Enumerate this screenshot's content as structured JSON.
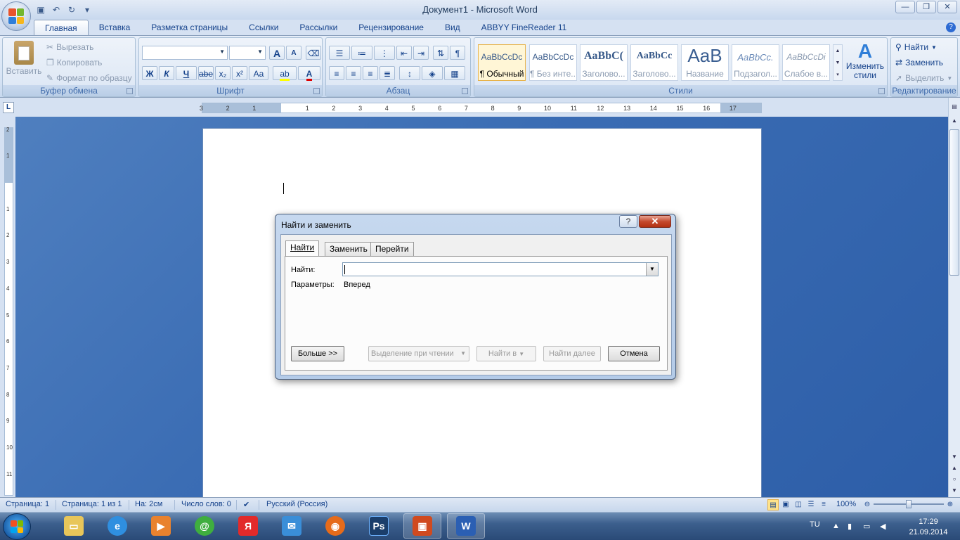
{
  "window": {
    "title": "Документ1 - Microsoft Word"
  },
  "colors": {
    "accent": "#15428b",
    "ribbon": "#d7e4f5",
    "doc_bg": "#3b6db4",
    "close": "#c54a2e"
  },
  "ribbon_tabs": [
    "Главная",
    "Вставка",
    "Разметка страницы",
    "Ссылки",
    "Рассылки",
    "Рецензирование",
    "Вид",
    "ABBYY FineReader 11"
  ],
  "clipboard": {
    "paste": "Вставить",
    "cut": "Вырезать",
    "copy": "Копировать",
    "format_painter": "Формат по образцу",
    "label": "Буфер обмена"
  },
  "font": {
    "label": "Шрифт",
    "bold": "Ж",
    "italic": "К",
    "underline": "Ч",
    "strike": "abe",
    "sub": "x₂",
    "sup": "x²",
    "case": "Aa",
    "grow": "A",
    "shrink": "A"
  },
  "paragraph": {
    "label": "Абзац"
  },
  "styles": {
    "label": "Стили",
    "items": [
      {
        "sample": "AaBbCcDc",
        "name": "¶ Обычный"
      },
      {
        "sample": "AaBbCcDc",
        "name": "¶ Без инте..."
      },
      {
        "sample": "AaBbC(",
        "name": "Заголово..."
      },
      {
        "sample": "AaBbCc",
        "name": "Заголово..."
      },
      {
        "sample": "AaB",
        "name": "Название"
      },
      {
        "sample": "AaBbCc.",
        "name": "Подзагол..."
      },
      {
        "sample": "AaBbCcDi",
        "name": "Слабое в..."
      }
    ],
    "change_styles": "Изменить стили"
  },
  "editing": {
    "label": "Редактирование",
    "find": "Найти",
    "replace": "Заменить",
    "select": "Выделить"
  },
  "ruler": {
    "h_ticks": [
      "3",
      "2",
      "1",
      "1",
      "2",
      "3",
      "4",
      "5",
      "6",
      "7",
      "8",
      "9",
      "10",
      "11",
      "12",
      "13",
      "14",
      "15",
      "16",
      "17"
    ],
    "v_ticks": [
      "2",
      "1",
      "1",
      "2",
      "3",
      "4",
      "5",
      "6",
      "7",
      "8",
      "9",
      "10",
      "11"
    ],
    "corner": "L"
  },
  "dialog": {
    "title": "Найти и заменить",
    "help": "?",
    "close": "✕",
    "tabs": [
      "Найти",
      "Заменить",
      "Перейти"
    ],
    "find_label": "Найти:",
    "find_value": "",
    "params_label": "Параметры:",
    "params_value": "Вперед",
    "more": "Больше >>",
    "reading_highlight": "Выделение при чтении",
    "find_in": "Найти в",
    "find_next": "Найти далее",
    "cancel": "Отмена"
  },
  "status": {
    "page": "Страница: 1",
    "pages": "Страница: 1 из 1",
    "at": "На: 2см",
    "words": "Число слов: 0",
    "language": "Русский (Россия)",
    "zoom": "100%"
  },
  "tray": {
    "lang": "TU",
    "time": "17:29",
    "date": "21.09.2014"
  }
}
